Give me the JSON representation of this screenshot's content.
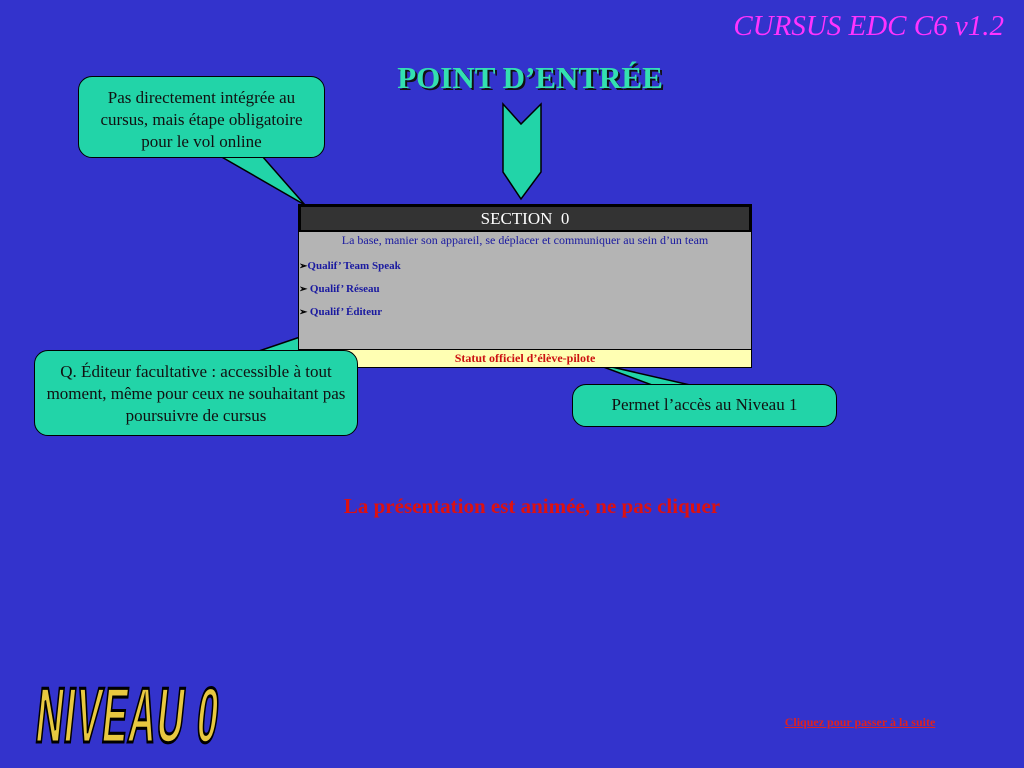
{
  "header": {
    "cursus_title": "CURSUS EDC C6 v1.2",
    "main_title": "POINT D’ENTRÉE"
  },
  "callouts": {
    "top": "Pas directement intégrée au cursus, mais étape obligatoire pour le vol online",
    "left": "Q. Éditeur facultative : accessible à tout moment, même pour ceux ne souhaitant pas poursuivre de cursus",
    "right": "Permet l’accès au Niveau 1"
  },
  "section": {
    "title": "SECTION  0",
    "description": "La base, manier son appareil, se déplacer et communiquer au sein d’un team",
    "qualifications": [
      {
        "bullet": "➢",
        "label": "Qualif’ Team Speak"
      },
      {
        "bullet": "➢ ",
        "label": " Qualif’ Réseau"
      },
      {
        "bullet": "➢ ",
        "label": " Qualif’ Éditeur"
      }
    ],
    "status": "Statut officiel d’élève-pilote"
  },
  "notes": {
    "animated": "La présentation est animée, ne pas cliquer"
  },
  "footer": {
    "level_badge": "NIVEAU 0",
    "next_link": "Cliquez pour passer à la suite"
  },
  "colors": {
    "background": "#3333cc",
    "bubble": "#22d4a8",
    "title_magenta": "#ff33ff",
    "badge_gold": "#e8c840"
  }
}
